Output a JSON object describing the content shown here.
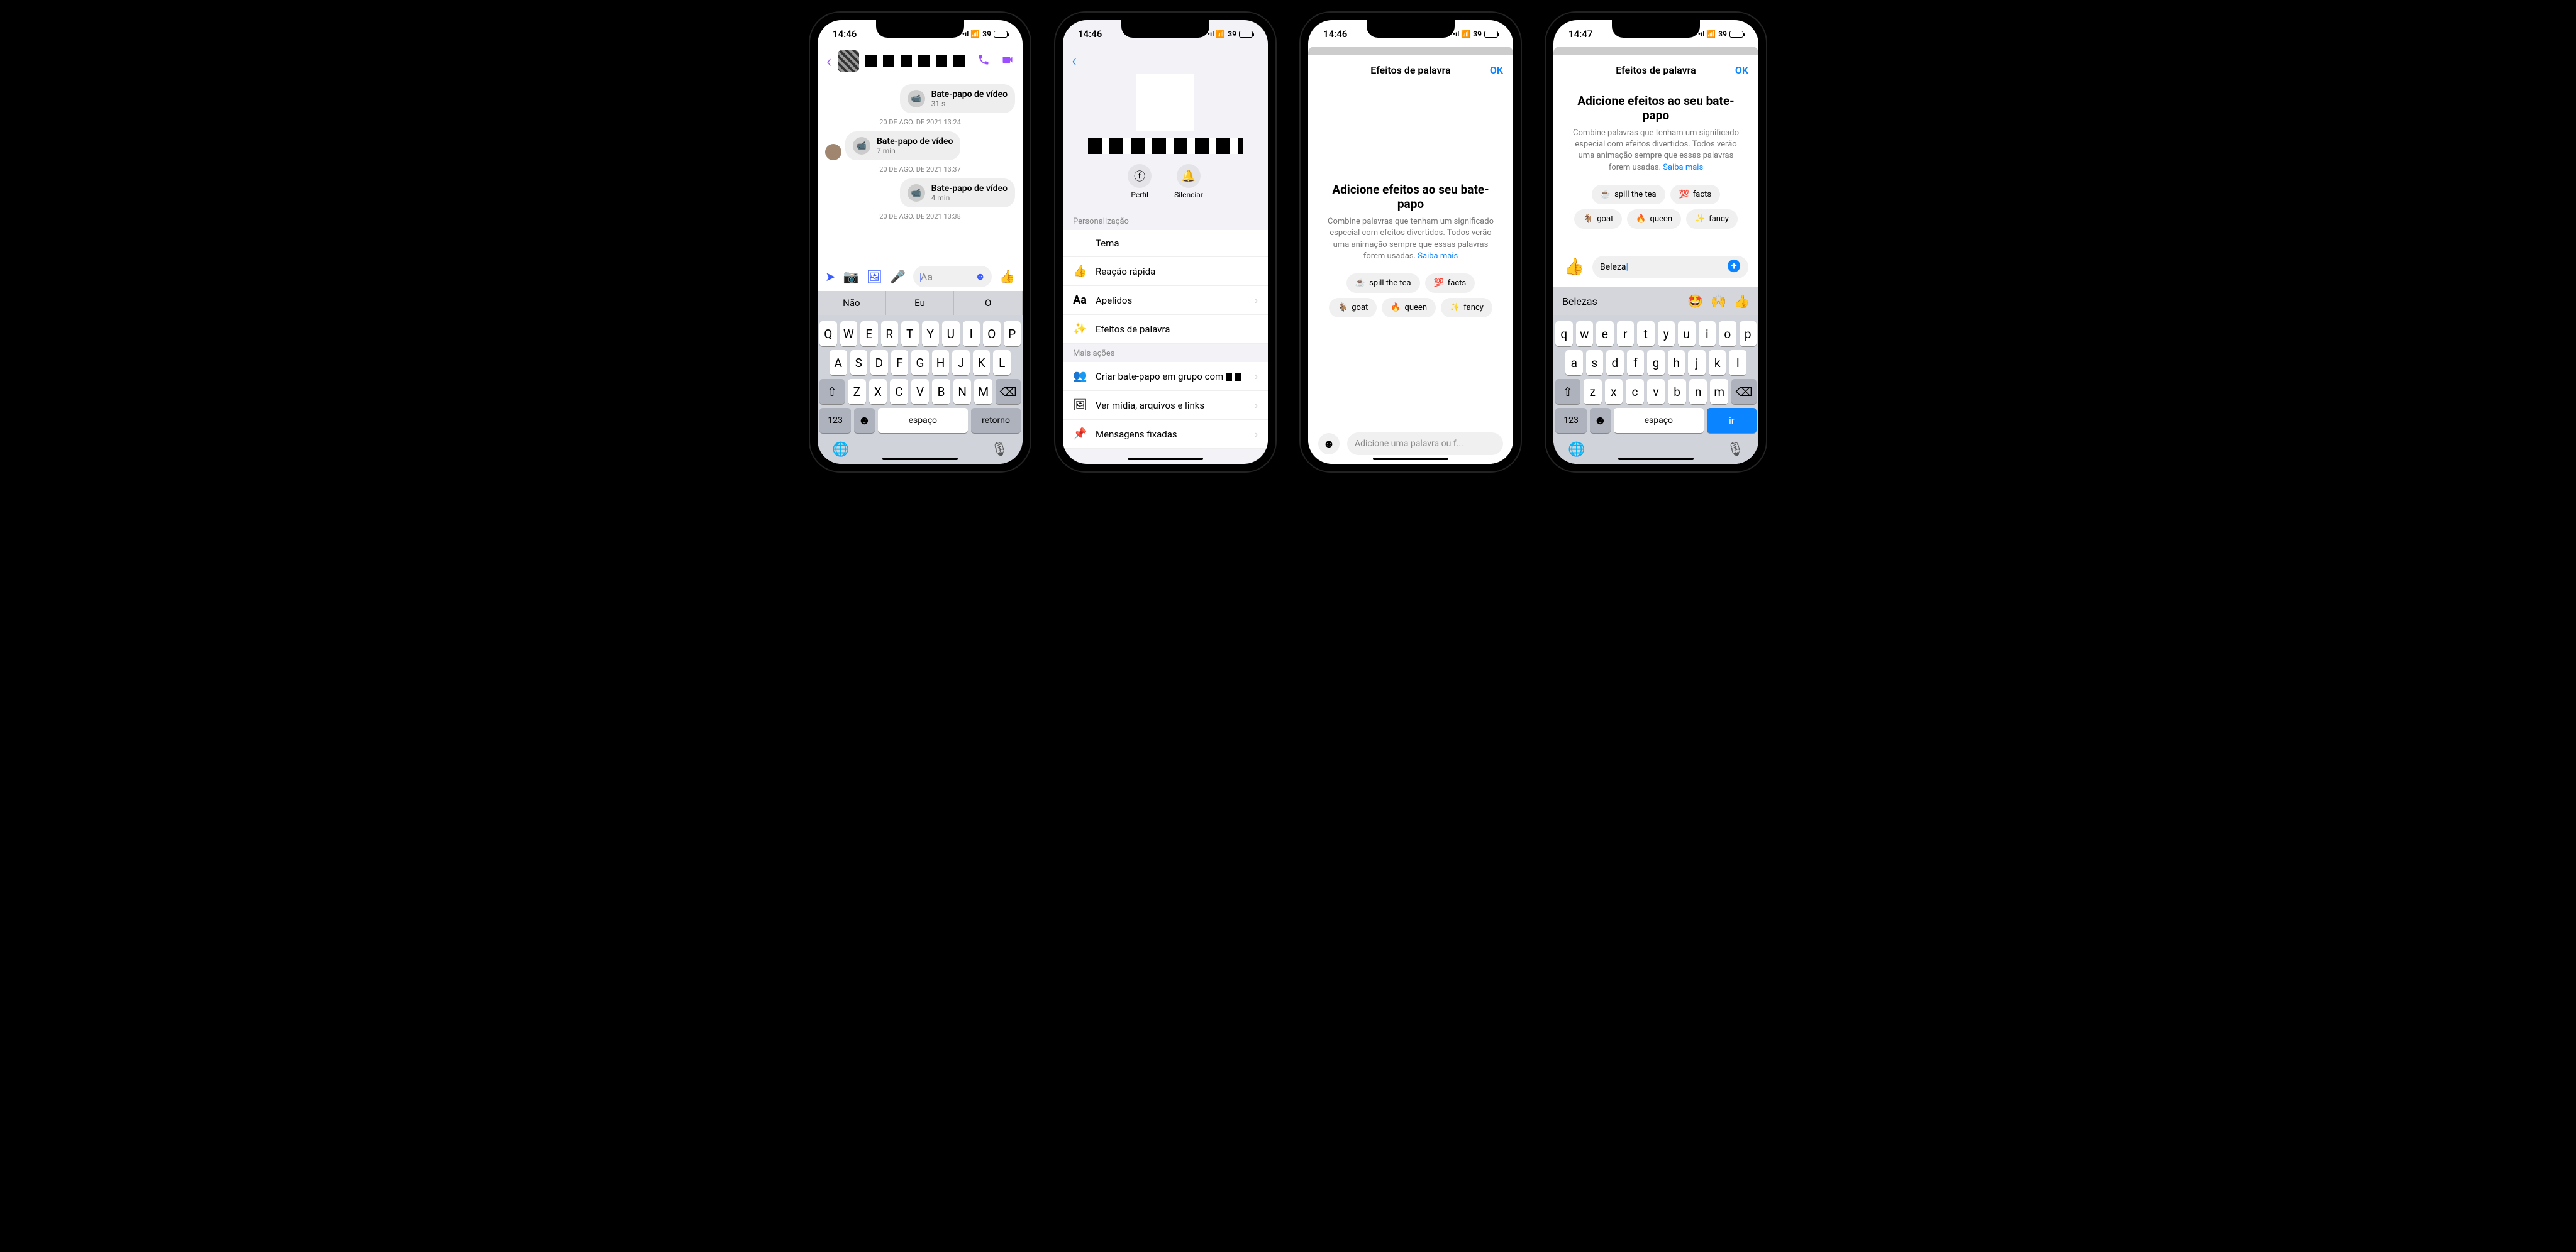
{
  "status": {
    "time1": "14:46",
    "time2": "14:47",
    "battery": "39"
  },
  "chat": {
    "msg_video": "Bate-papo de vídeo",
    "dur1": "31 s",
    "dur2": "7 min",
    "dur3": "4 min",
    "ts1": "20 DE AGO. DE 2021 13:24",
    "ts2": "20 DE AGO. DE 2021 13:37",
    "ts3": "20 DE AGO. DE 2021 13:38",
    "placeholder": "Aa",
    "sug1": "Não",
    "sug2": "Eu",
    "sug3": "O"
  },
  "keyboard": {
    "space": "espaço",
    "return": "retorno",
    "ir": "ir",
    "mode": "123"
  },
  "settings": {
    "profile_action": "Perfil",
    "mute_action": "Silenciar",
    "section1": "Personalização",
    "theme": "Tema",
    "quick_reaction": "Reação rápida",
    "nicknames": "Apelidos",
    "word_effects": "Efeitos de palavra",
    "section2": "Mais ações",
    "group_chat": "Criar bate-papo em grupo com",
    "media": "Ver mídia, arquivos e links",
    "pinned": "Mensagens fixadas"
  },
  "effects": {
    "header": "Efeitos de palavra",
    "ok": "OK",
    "title": "Adicione efeitos ao seu bate-papo",
    "desc": "Combine palavras que tenham um significado especial com efeitos divertidos. Todos verão uma animação sempre que essas palavras forem usadas.",
    "learn_more": "Saiba mais",
    "pill1": "spill the tea",
    "pill2": "facts",
    "pill3": "goat",
    "pill4": "queen",
    "pill5": "fancy",
    "placeholder": "Adicione uma palavra ou f...",
    "input_value": "Beleza",
    "suggestion": "Belezas"
  }
}
